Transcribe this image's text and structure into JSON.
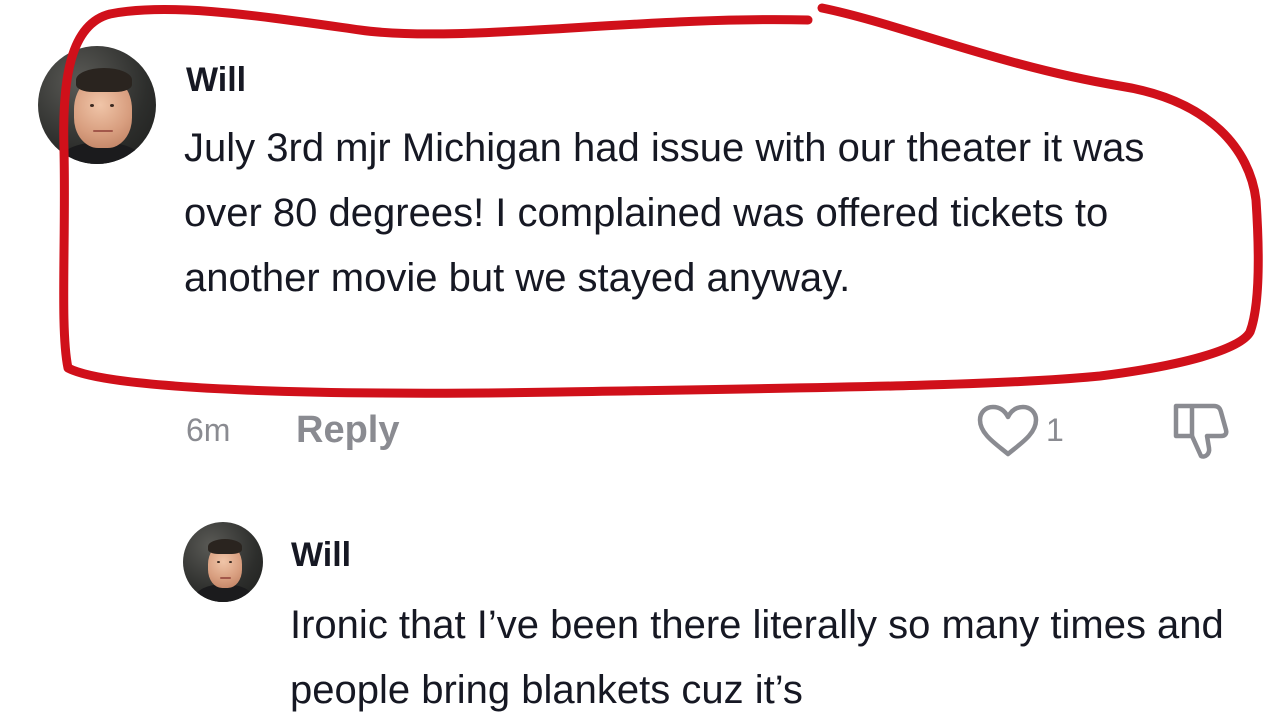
{
  "main_comment": {
    "username": "Will",
    "text": "July 3rd mjr Michigan had issue with our theater it was over 80 degrees! I complained was offered tickets to another movie but we stayed anyway.",
    "time": "6m",
    "reply_label": "Reply",
    "like_count": "1"
  },
  "reply_comment": {
    "username": "Will",
    "text": "Ironic that I’ve been there literally so many times and people bring blankets cuz it’s"
  },
  "icons": {
    "like": "heart-icon",
    "dislike": "thumbs-down-icon"
  },
  "colors": {
    "annotation_outline": "#d0101a",
    "muted_text": "#8a8b91",
    "primary_text": "#161823"
  }
}
